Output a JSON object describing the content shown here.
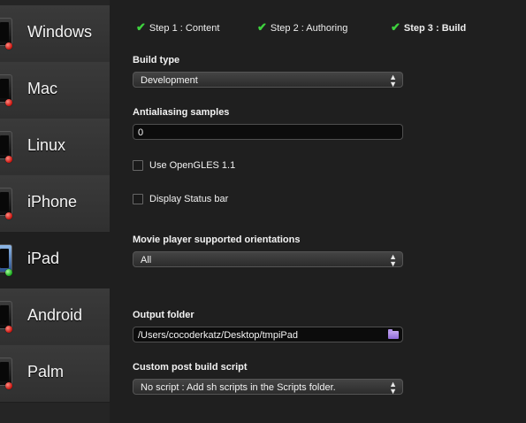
{
  "sidebar": {
    "platforms": [
      {
        "label": "Windows",
        "status": "red"
      },
      {
        "label": "Mac",
        "status": "red"
      },
      {
        "label": "Linux",
        "status": "red"
      },
      {
        "label": "iPhone",
        "status": "red"
      },
      {
        "label": "iPad",
        "status": "green"
      },
      {
        "label": "Android",
        "status": "red"
      },
      {
        "label": "Palm",
        "status": "red"
      }
    ],
    "selected": "iPad"
  },
  "steps": [
    {
      "label": "Step 1 : Content",
      "done": true
    },
    {
      "label": "Step 2 : Authoring",
      "done": true
    },
    {
      "label": "Step 3 : Build",
      "done": true,
      "active": true
    }
  ],
  "form": {
    "build_type": {
      "label": "Build type",
      "value": "Development"
    },
    "antialiasing": {
      "label": "Antialiasing samples",
      "value": "0"
    },
    "use_opengles": {
      "label": "Use OpenGLES 1.1",
      "checked": false
    },
    "display_status_bar": {
      "label": "Display Status bar",
      "checked": false
    },
    "orientations": {
      "label": "Movie player supported orientations",
      "value": "All"
    },
    "output_folder": {
      "label": "Output folder",
      "value": "/Users/cocoderkatz/Desktop/tmpiPad"
    },
    "post_build_script": {
      "label": "Custom post build script",
      "value": "No script : Add sh scripts in the Scripts folder."
    }
  },
  "colors": {
    "check": "#3ed23e",
    "status_red": "#c8120c",
    "status_green": "#15a51a",
    "folder_icon": "#9b7ae0"
  }
}
